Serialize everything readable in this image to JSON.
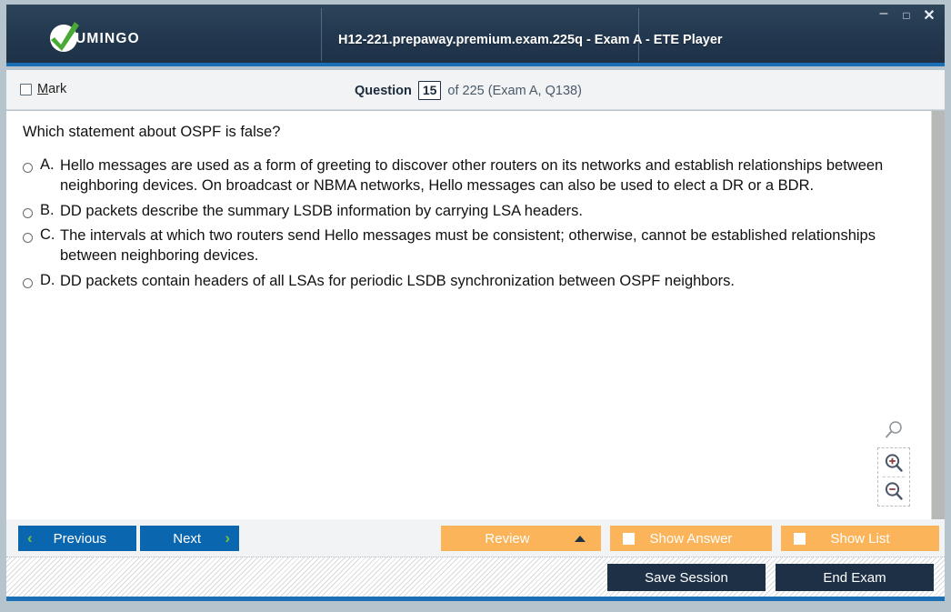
{
  "window": {
    "title": "H12-221.prepaway.premium.exam.225q - Exam A - ETE Player",
    "brand_name": "UMINGO",
    "controls": {
      "minimize": "–",
      "maximize": "□",
      "close": "✕"
    },
    "accent_blue": "#1a6fb5",
    "titlebar_dark": "#233950"
  },
  "status": {
    "mark_label_prefix": "",
    "mark_label_accel": "M",
    "mark_label_rest": "ark",
    "question_word": "Question",
    "question_number": "15",
    "of_text": "of 225 (Exam A, Q138)"
  },
  "question": {
    "prompt": "Which statement about OSPF is false?",
    "choices": [
      {
        "letter": "A.",
        "text": "Hello messages are used as a form of greeting to discover other routers on its networks and establish relationships between neighboring devices. On broadcast or NBMA networks, Hello messages can also be used to elect a DR or a BDR.",
        "selected": false
      },
      {
        "letter": "B.",
        "text": "DD packets describe the summary LSDB information by carrying LSA headers.",
        "selected": false
      },
      {
        "letter": "C.",
        "text": "The intervals at which two routers send Hello messages must be consistent; otherwise, cannot be established relationships between neighboring devices.",
        "selected": false
      },
      {
        "letter": "D.",
        "text": "DD packets contain headers of all LSAs for periodic LSDB synchronization between OSPF neighbors.",
        "selected": false
      }
    ]
  },
  "zoom_tools": {
    "reset": "zoom-reset-icon",
    "zoom_in": "zoom-in-icon",
    "zoom_out": "zoom-out-icon"
  },
  "toolbar": {
    "previous": "Previous",
    "next": "Next",
    "review": "Review",
    "show_answer": "Show Answer",
    "show_list": "Show List",
    "prev_chevron": "‹",
    "next_chevron": "›"
  },
  "footer": {
    "save_session": "Save Session",
    "end_exam": "End Exam"
  }
}
